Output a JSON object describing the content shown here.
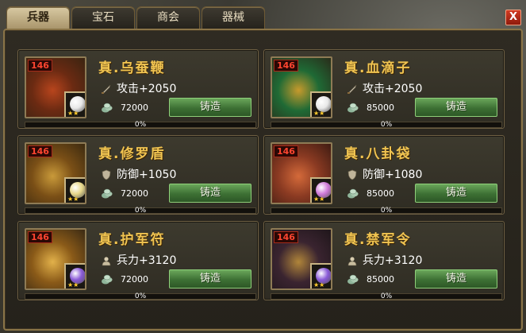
{
  "tabs": [
    {
      "label": "兵器",
      "active": true
    },
    {
      "label": "宝石",
      "active": false
    },
    {
      "label": "商会",
      "active": false
    },
    {
      "label": "器械",
      "active": false
    }
  ],
  "close_label": "X",
  "forge_label": "铸造",
  "items": [
    {
      "name": "真.乌蚕鞭",
      "level": "146",
      "stat_icon": "sword-icon",
      "stat": "攻击+2050",
      "price": "72000",
      "progress_text": "0%",
      "progress": 0,
      "gem": "white-gem",
      "gem_color": "#e8e8e8",
      "art": [
        "#6b2a12",
        "#b8451d",
        "#3a2411"
      ]
    },
    {
      "name": "真.血滴子",
      "level": "146",
      "stat_icon": "sword-icon",
      "stat": "攻击+2050",
      "price": "85000",
      "progress_text": "0%",
      "progress": 0,
      "gem": "white-gem",
      "gem_color": "#e8e8e8",
      "art": [
        "#1f6a35",
        "#c79a2c",
        "#2a2c1a"
      ]
    },
    {
      "name": "真.修罗盾",
      "level": "146",
      "stat_icon": "shield-icon",
      "stat": "防御+1050",
      "price": "72000",
      "progress_text": "0%",
      "progress": 0,
      "gem": "yellow-gem",
      "gem_color": "#e8d88a",
      "art": [
        "#7a4f16",
        "#c99a3a",
        "#3c2a10"
      ]
    },
    {
      "name": "真.八卦袋",
      "level": "146",
      "stat_icon": "shield-icon",
      "stat": "防御+1080",
      "price": "85000",
      "progress_text": "0%",
      "progress": 0,
      "gem": "pink-gem",
      "gem_color": "#d07ad8",
      "art": [
        "#8a3a22",
        "#d46a3a",
        "#3f1c12"
      ]
    },
    {
      "name": "真.护军符",
      "level": "146",
      "stat_icon": "soldier-icon",
      "stat": "兵力+3120",
      "price": "72000",
      "progress_text": "0%",
      "progress": 0,
      "gem": "purple-gem",
      "gem_color": "#8a5ad8",
      "art": [
        "#8a5a18",
        "#e2b14a",
        "#3a2a14"
      ]
    },
    {
      "name": "真.禁军令",
      "level": "146",
      "stat_icon": "soldier-icon",
      "stat": "兵力+3120",
      "price": "85000",
      "progress_text": "0%",
      "progress": 0,
      "gem": "purple-gem",
      "gem_color": "#8a5ad8",
      "art": [
        "#3a2430",
        "#b0853a",
        "#1f161a"
      ]
    }
  ],
  "colors": {
    "name_gold": "#f0c451",
    "level_red": "#ff4530",
    "forge_green": "#4a8a3e",
    "panel_border": "#8a7447"
  }
}
